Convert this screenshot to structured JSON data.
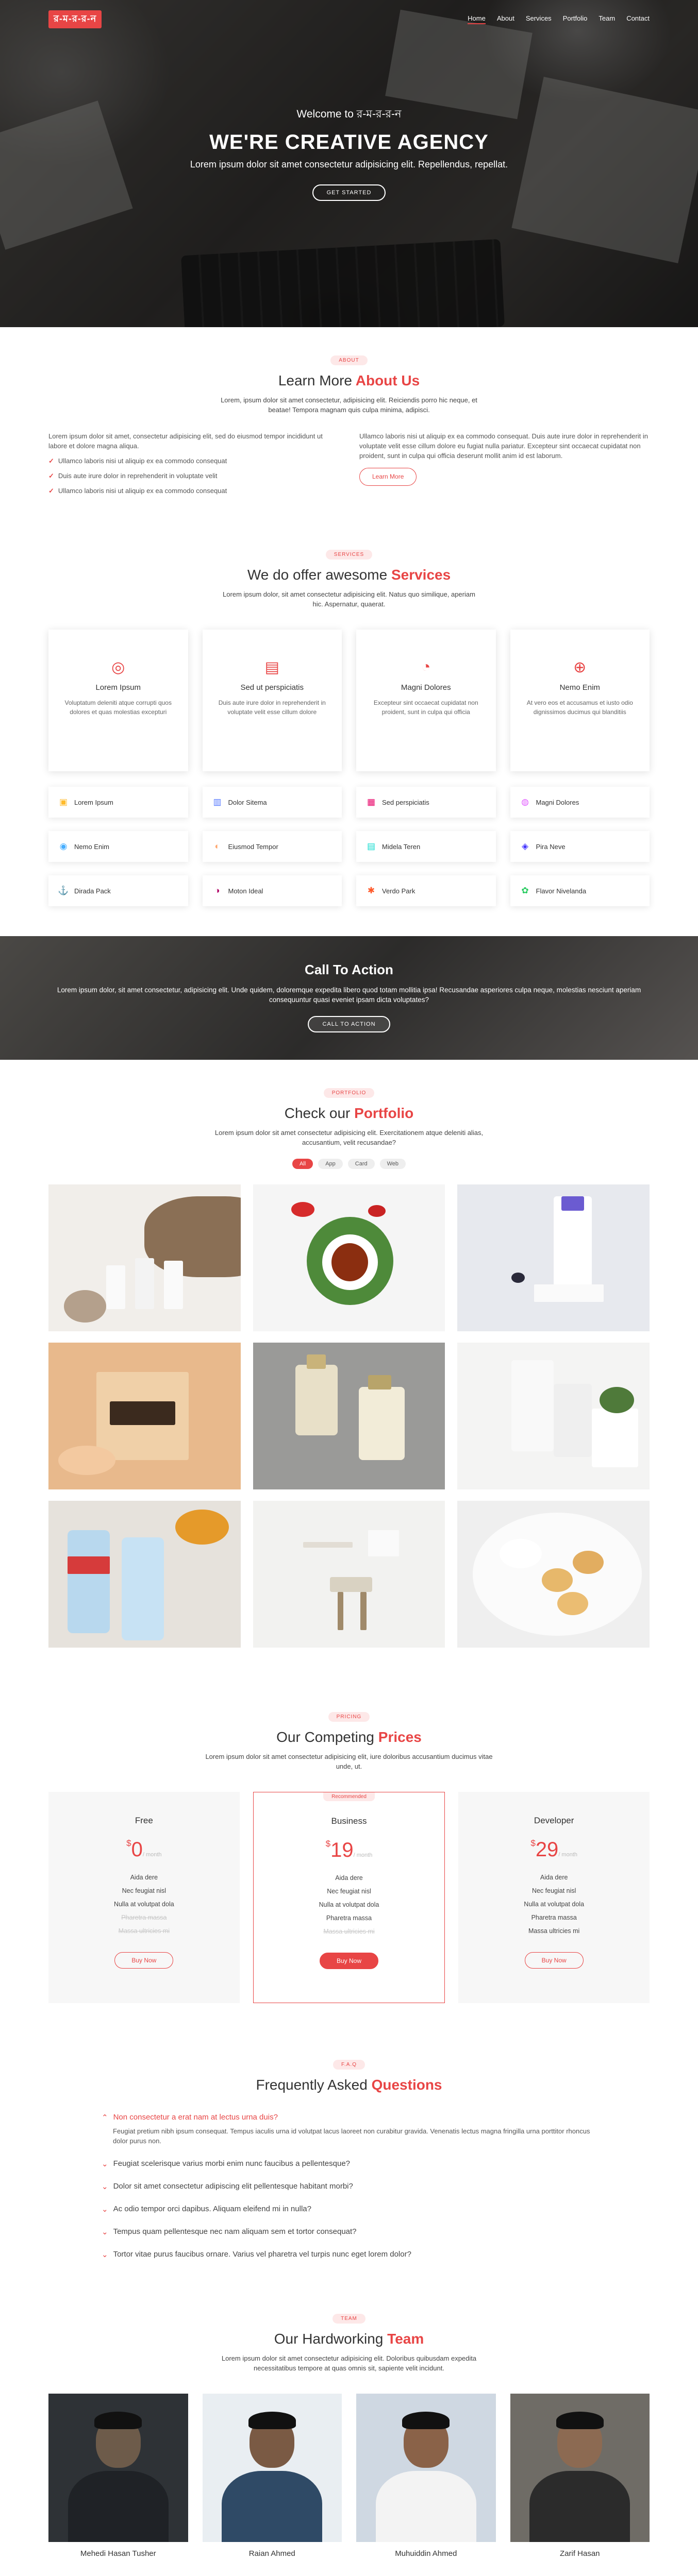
{
  "header": {
    "logo": "র-ম-র-র-ন",
    "nav": [
      "Home",
      "About",
      "Services",
      "Portfolio",
      "Team",
      "Contact"
    ],
    "active": "Home",
    "welcome": "Welcome to র-ম-র-র-ন",
    "title": "WE'RE CREATIVE AGENCY",
    "subtitle": "Lorem ipsum dolor sit amet consectetur adipisicing elit. Repellendus, repellat.",
    "cta": "GET STARTED"
  },
  "about": {
    "tag": "ABOUT",
    "title_a": "Learn More",
    "title_b": "About Us",
    "desc": "Lorem, ipsum dolor sit amet consectetur, adipisicing elit. Reiciendis porro hic neque, et beatae! Tempora magnam quis culpa minima, adipisci.",
    "left_text": "Lorem ipsum dolor sit amet, consectetur adipisicing elit, sed do eiusmod tempor incididunt ut labore et dolore magna aliqua.",
    "bullets": [
      "Ullamco laboris nisi ut aliquip ex ea commodo consequat",
      "Duis aute irure dolor in reprehenderit in voluptate velit",
      "Ullamco laboris nisi ut aliquip ex ea commodo consequat"
    ],
    "right_text": "Ullamco laboris nisi ut aliquip ex ea commodo consequat. Duis aute irure dolor in reprehenderit in voluptate velit esse cillum dolore eu fugiat nulla pariatur. Excepteur sint occaecat cupidatat non proident, sunt in culpa qui officia deserunt mollit anim id est laborum.",
    "learn_more": "Learn More"
  },
  "services": {
    "tag": "SERVICES",
    "title_a": "We do offer awesome",
    "title_b": "Services",
    "desc": "Lorem ipsum dolor, sit amet consectetur adipisicing elit. Natus quo similique, aperiam hic. Aspernatur, quaerat.",
    "cards": [
      {
        "icon": "dribbble-icon",
        "glyph": "◎",
        "title": "Lorem Ipsum",
        "text": "Voluptatum deleniti atque corrupti quos dolores et quas molestias excepturi"
      },
      {
        "icon": "file-icon",
        "glyph": "▤",
        "title": "Sed ut perspiciatis",
        "text": "Duis aute irure dolor in reprehenderit in voluptate velit esse cillum dolore"
      },
      {
        "icon": "speedometer-icon",
        "glyph": "◔",
        "title": "Magni Dolores",
        "text": "Excepteur sint occaecat cupidatat non proident, sunt in culpa qui officia"
      },
      {
        "icon": "world-icon",
        "glyph": "⊕",
        "title": "Nemo Enim",
        "text": "At vero eos et accusamus et iusto odio dignissimos ducimus qui blanditiis"
      }
    ],
    "items": [
      {
        "label": "Lorem Ipsum",
        "icon": "store-icon",
        "glyph": "▣",
        "color": "#ffbb2c"
      },
      {
        "label": "Dolor Sitema",
        "icon": "bar-chart-icon",
        "glyph": "▥",
        "color": "#5578ff"
      },
      {
        "label": "Sed perspiciatis",
        "icon": "calendar-icon",
        "glyph": "▦",
        "color": "#e80368"
      },
      {
        "label": "Magni Dolores",
        "icon": "paint-icon",
        "glyph": "◍",
        "color": "#e361ff"
      },
      {
        "label": "Nemo Enim",
        "icon": "database-icon",
        "glyph": "◉",
        "color": "#47aeff"
      },
      {
        "label": "Eiusmod Tempor",
        "icon": "gradienter-icon",
        "glyph": "◐",
        "color": "#ffa76e"
      },
      {
        "label": "Midela Teren",
        "icon": "file-list-icon",
        "glyph": "▤",
        "color": "#11dbcf"
      },
      {
        "label": "Pira Neve",
        "icon": "price-tag-icon",
        "glyph": "◈",
        "color": "#4233ff"
      },
      {
        "label": "Dirada Pack",
        "icon": "anchor-icon",
        "glyph": "⚓",
        "color": "#b2904f"
      },
      {
        "label": "Moton Ideal",
        "icon": "disc-icon",
        "glyph": "◑",
        "color": "#b20969"
      },
      {
        "label": "Verdo Park",
        "icon": "base-station-icon",
        "glyph": "✱",
        "color": "#ff5828"
      },
      {
        "label": "Flavor Nivelanda",
        "icon": "fingerprint-icon",
        "glyph": "✿",
        "color": "#29cc61"
      }
    ]
  },
  "cta": {
    "title": "Call To Action",
    "text": "Lorem ipsum dolor, sit amet consectetur, adipisicing elit. Unde quidem, doloremque expedita libero quod totam mollitia ipsa! Recusandae asperiores culpa neque, molestias nesciunt aperiam consequuntur quasi eveniet ipsam dicta voluptates?",
    "button": "CALL TO ACTION"
  },
  "portfolio": {
    "tag": "PORTFOLIO",
    "title_a": "Check our",
    "title_b": "Portfolio",
    "desc": "Lorem ipsum dolor sit amet consectetur adipisicing elit. Exercitationem atque deleniti alias, accusantium, velit recusandae?",
    "filters": [
      "All",
      "App",
      "Card",
      "Web"
    ],
    "active_filter": "All",
    "items": [
      "basket-bottles",
      "tea-cup",
      "tube-product",
      "honest-box",
      "perfume-bottles",
      "cosmetic-bottle",
      "water-bottles",
      "chair-desk",
      "cookies-plate"
    ]
  },
  "pricing": {
    "tag": "PRICING",
    "title_a": "Our Competing",
    "title_b": "Prices",
    "desc": "Lorem ipsum dolor sit amet consectetur adipisicing elit, iure doloribus accusantium ducimus vitae unde, ut.",
    "plans": [
      {
        "name": "Free",
        "currency": "$",
        "price": "0",
        "period": "/ month",
        "features": [
          [
            "Aida dere",
            true
          ],
          [
            "Nec feugiat nisl",
            true
          ],
          [
            "Nulla at volutpat dola",
            true
          ],
          [
            "Pharetra massa",
            false
          ],
          [
            "Massa ultricies mi",
            false
          ]
        ],
        "button": "Buy Now",
        "featured": false
      },
      {
        "name": "Business",
        "badge": "Recommended",
        "currency": "$",
        "price": "19",
        "period": "/ month",
        "features": [
          [
            "Aida dere",
            true
          ],
          [
            "Nec feugiat nisl",
            true
          ],
          [
            "Nulla at volutpat dola",
            true
          ],
          [
            "Pharetra massa",
            true
          ],
          [
            "Massa ultricies mi",
            false
          ]
        ],
        "button": "Buy Now",
        "featured": true
      },
      {
        "name": "Developer",
        "currency": "$",
        "price": "29",
        "period": "/ month",
        "features": [
          [
            "Aida dere",
            true
          ],
          [
            "Nec feugiat nisl",
            true
          ],
          [
            "Nulla at volutpat dola",
            true
          ],
          [
            "Pharetra massa",
            true
          ],
          [
            "Massa ultricies mi",
            true
          ]
        ],
        "button": "Buy Now",
        "featured": false
      }
    ]
  },
  "faq": {
    "tag": "F.A.Q",
    "title_a": "Frequently Asked",
    "title_b": "Questions",
    "open_q": "Non consectetur a erat nam at lectus urna duis?",
    "open_a": "Feugiat pretium nibh ipsum consequat. Tempus iaculis urna id volutpat lacus laoreet non curabitur gravida. Venenatis lectus magna fringilla urna porttitor rhoncus dolor purus non.",
    "questions": [
      "Feugiat scelerisque varius morbi enim nunc faucibus a pellentesque?",
      "Dolor sit amet consectetur adipiscing elit pellentesque habitant morbi?",
      "Ac odio tempor orci dapibus. Aliquam eleifend mi in nulla?",
      "Tempus quam pellentesque nec nam aliquam sem et tortor consequat?",
      "Tortor vitae purus faucibus ornare. Varius vel pharetra vel turpis nunc eget lorem dolor?"
    ]
  },
  "team": {
    "tag": "TEAM",
    "title_a": "Our Hardworking",
    "title_b": "Team",
    "desc": "Lorem ipsum dolor sit amet consectetur adipisicing elit. Doloribus quibusdam expedita necessitatibus tempore at quas omnis sit, sapiente velit incidunt.",
    "members": [
      "Mehedi Hasan Tusher",
      "Raian Ahmed",
      "Muhuiddin Ahmed",
      "Zarif Hasan"
    ]
  },
  "colors": {
    "accent": "#e84545"
  }
}
